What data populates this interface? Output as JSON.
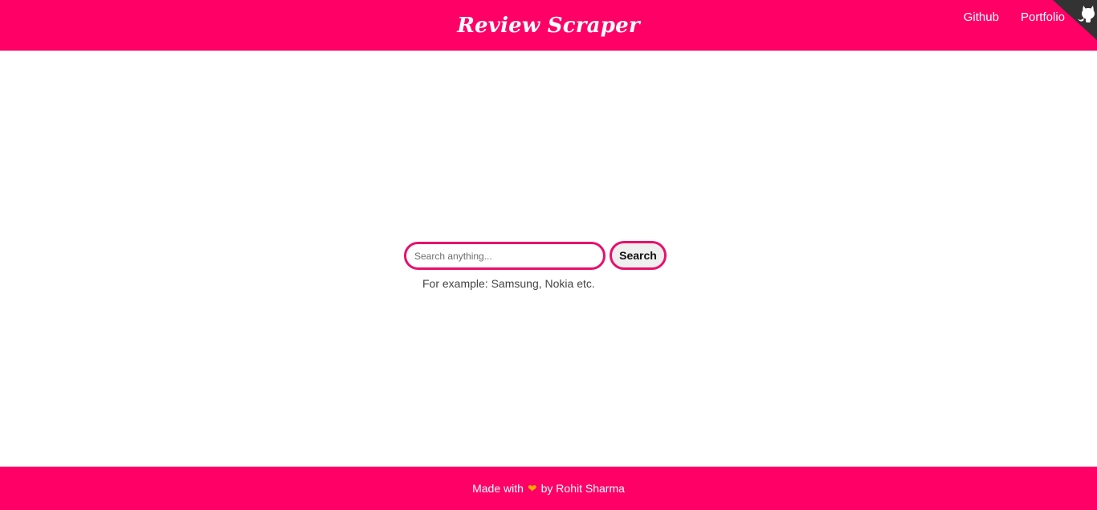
{
  "header": {
    "title": "Review Scraper",
    "nav": [
      {
        "label": "Github"
      },
      {
        "label": "Portfolio"
      }
    ],
    "corner_icon": "github-octocat-icon"
  },
  "search": {
    "placeholder": "Search anything...",
    "value": "",
    "button_label": "Search",
    "hint": "For example: Samsung, Nokia etc."
  },
  "footer": {
    "prefix": "Made with",
    "heart_icon": "heart-icon",
    "suffix": "by Rohit Sharma"
  },
  "colors": {
    "brand": "#ff0066",
    "input_border": "#e8106b",
    "heart": "#ffa500",
    "corner": "#333333"
  }
}
